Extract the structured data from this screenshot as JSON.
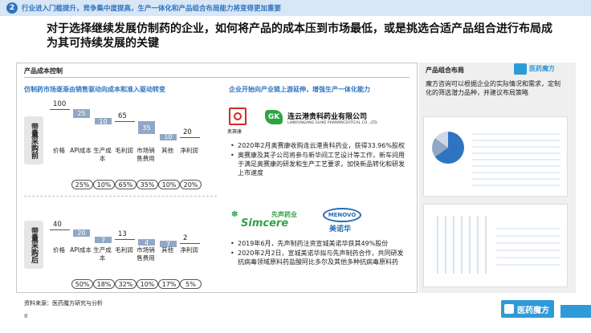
{
  "section": {
    "number": "2",
    "text": "行业进入门槛提升，竞争集中度提高，生产一体化和产品组合布局能力将变得更加重要"
  },
  "title": "对于选择继续发展仿制药的企业，如何将产品的成本压到市场最低，或是挑选合适产品组合进行布局成为其可持续发展的关键",
  "left": {
    "panel_title": "产品成本控制",
    "left_subhead": "仿制药市场逐渐由销售驱动向成本和准入驱动转变",
    "right_subhead": "企业开始向产业链上游延伸，增强生产一体化能力",
    "before_label": "带量采购前",
    "after_label": "带量采购后"
  },
  "chart_data": [
    {
      "type": "bar",
      "title": "带量采购前",
      "categories": [
        "价格",
        "API成本",
        "生产成本",
        "毛利润",
        "市场销售费用",
        "其他",
        "净利润"
      ],
      "values": [
        100,
        25,
        10,
        65,
        35,
        10,
        20
      ],
      "percents": [
        "25%",
        "10%",
        "65%",
        "35%",
        "10%",
        "20%"
      ],
      "ylim": [
        0,
        100
      ]
    },
    {
      "type": "bar",
      "title": "带量采购后",
      "categories": [
        "价格",
        "API成本",
        "生产成本",
        "毛利润",
        "市场销售费用",
        "其他",
        "净利润"
      ],
      "values": [
        40,
        20,
        7,
        13,
        4,
        7,
        2
      ],
      "percents": [
        "50%",
        "18%",
        "32%",
        "10%",
        "17%",
        "5%"
      ],
      "ylim": [
        0,
        100
      ]
    }
  ],
  "company1": {
    "logo_caption": "奥赛康",
    "name_cn": "连云港贵科药业有限公司",
    "name_en": "LIANYUNGANG GUIKE PHARMACEUTICAL CO., LTD.",
    "bullets": [
      "2020年2月奥赛康收购连云港贵科药业，获得33.96%股权",
      "奥赛康及其子公司将参与新华间工艺设计等工作，新车间用于满足奥赛康的研发和生产工艺要求，加快新品转化和研发上市速度"
    ]
  },
  "company2": {
    "logo1_cn": "先声药业",
    "logo1_en": "Simcere",
    "logo2_en": "MENOVO",
    "logo2_cn": "美诺华",
    "bullets": [
      "2019年6月，先声制药注资宣城美诺华获其49%股份",
      "2020年2月2日，宣城美诺华拟与先声制药合作，共同研发抗病毒领域原料药盐酸阿比多尔及其他多种抗病毒原料药"
    ]
  },
  "right": {
    "title": "产品组合布局",
    "logo_text": "医药魔方",
    "desc": "魔方咨询可以根据企业的实际情况和需求，定制化的筛选潜力品种，并建议布局策略"
  },
  "footer": {
    "source": "资料来源：医药魔方研究与分析",
    "page": "8",
    "logo_text": "医药魔方"
  },
  "colors": {
    "accent": "#2f74c0",
    "bar": "#8fa8c6",
    "logo_blue": "#2f9bd6"
  }
}
